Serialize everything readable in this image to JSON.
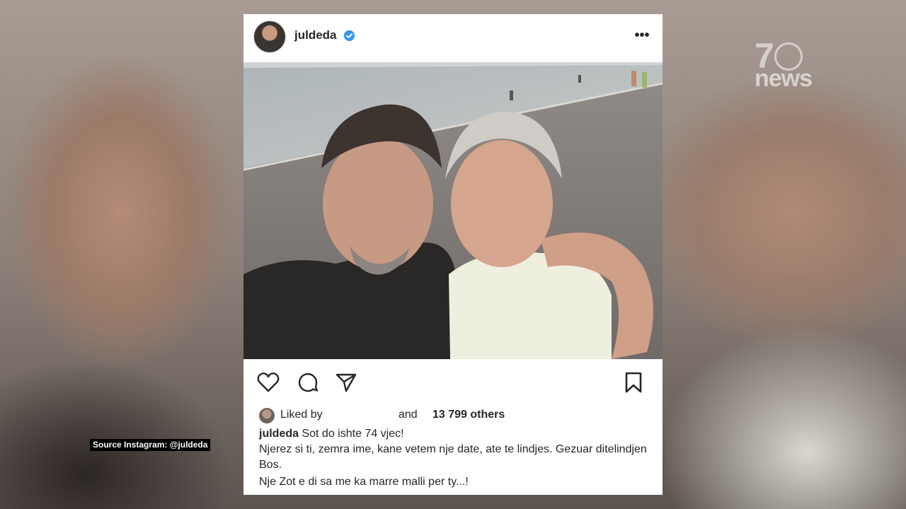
{
  "channel": {
    "logo_number": "7",
    "logo_word": "news",
    "source_caption": "Source Instagram: @juldeda"
  },
  "post": {
    "username": "juldeda",
    "verified": true,
    "more_icon": "more-dots-icon",
    "photo_description_icon": "beach-selfie-photo",
    "actions": {
      "like_icon": "heart-icon",
      "comment_icon": "comment-icon",
      "share_icon": "send-icon",
      "save_icon": "bookmark-icon"
    },
    "likes": {
      "prefix": "Liked by",
      "and": "and",
      "count_text": "13 799 others"
    },
    "caption": {
      "username": "juldeda",
      "line1": "Sot do ishte 74 vjec!",
      "line2": "Njerez si ti, zemra ime, kane vetem nje date, ate te lindjes. Gezuar ditelindjen Bos.",
      "line3": "Nje Zot e di sa me ka marre malli per ty...!"
    }
  },
  "colors": {
    "text": "#262626",
    "verified_blue": "#3897f0",
    "card_bg": "#ffffff"
  }
}
